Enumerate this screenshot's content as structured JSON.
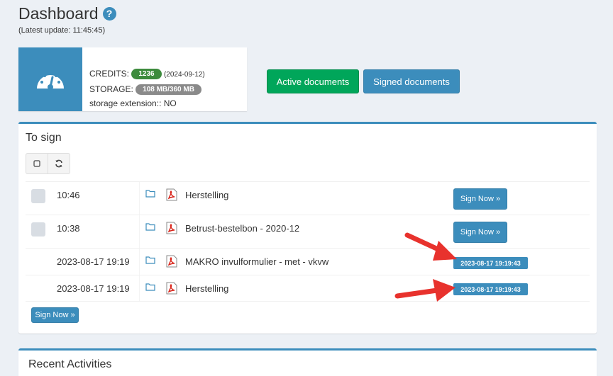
{
  "header": {
    "title": "Dashboard",
    "help_glyph": "?",
    "last_update": "(Latest update: 11:45:45)"
  },
  "info_box": {
    "icon": "dashboard-gauge-icon",
    "credits_label": "CREDITS:",
    "credits_value": "1236",
    "credits_date": "(2024-09-12)",
    "storage_label": "STORAGE:",
    "storage_value": "108 MB/360 MB",
    "extension_text": "storage extension:: NO"
  },
  "buttons": {
    "active_documents": "Active documents",
    "signed_documents": "Signed documents"
  },
  "to_sign": {
    "title": "To sign",
    "rows": [
      {
        "time": "10:46",
        "name": "Herstelling",
        "action": "Sign Now »"
      },
      {
        "time": "10:38",
        "name": "Betrust-bestelbon - 2020-12",
        "action": "Sign Now »"
      },
      {
        "time": "2023-08-17 19:19",
        "name": "MAKRO invulformulier - met - vkvw",
        "stamp": "2023-08-17 19:19:43"
      },
      {
        "time": "2023-08-17 19:19",
        "name": "Herstelling",
        "stamp": "2023-08-17 19:19:43"
      }
    ],
    "bottom_action": "Sign Now »"
  },
  "recent": {
    "title": "Recent Activities"
  },
  "colors": {
    "primary": "#3c8dbc",
    "success": "#00a65a",
    "arrow": "#e8322d"
  }
}
